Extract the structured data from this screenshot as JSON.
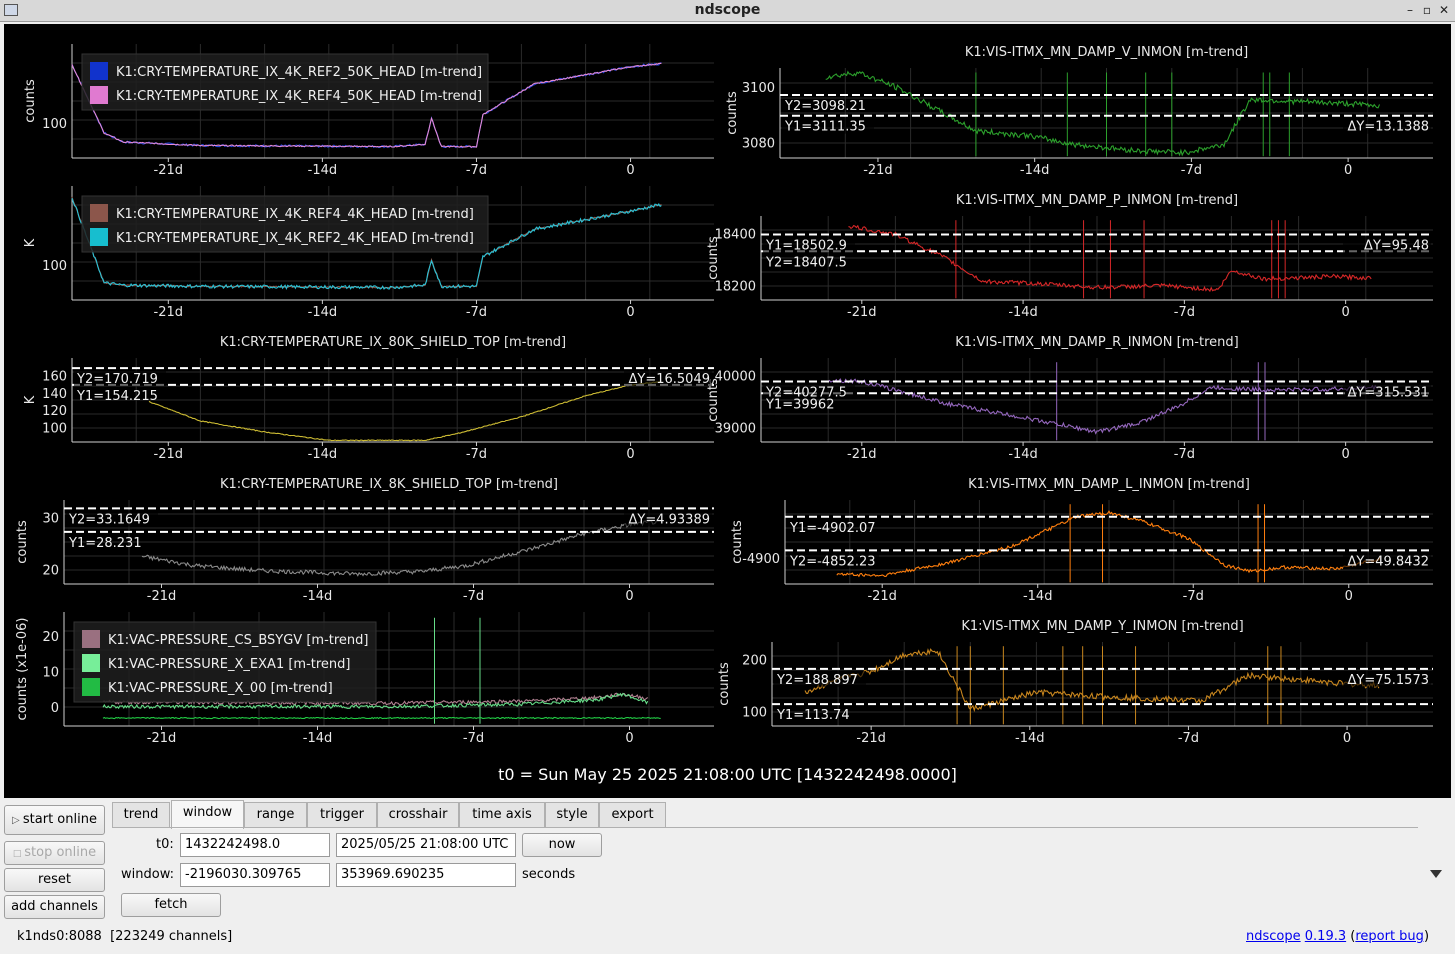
{
  "window": {
    "title": "ndscope",
    "minimize_glyph": "–",
    "maximize_glyph": "▫",
    "close_glyph": "✕"
  },
  "t0_label": "t0 = Sun May 25 2025 21:08:00 UTC [1432242498.0000]",
  "x_ticks": [
    "-21d",
    "-14d",
    "-7d",
    "0"
  ],
  "plots": [
    {
      "id": "left1",
      "ylabel": "counts",
      "yticks": [
        "100"
      ],
      "legend": [
        {
          "name": "K1:CRY-TEMPERATURE_IX_4K_REF2_50K_HEAD [m-trend]",
          "color": "#1133cc"
        },
        {
          "name": "K1:CRY-TEMPERATURE_IX_4K_REF4_50K_HEAD [m-trend]",
          "color": "#e07ad0"
        }
      ]
    },
    {
      "id": "left2",
      "ylabel": "K",
      "yticks": [
        "100"
      ],
      "legend": [
        {
          "name": "K1:CRY-TEMPERATURE_IX_4K_REF4_4K_HEAD [m-trend]",
          "color": "#8c564b"
        },
        {
          "name": "K1:CRY-TEMPERATURE_IX_4K_REF2_4K_HEAD [m-trend]",
          "color": "#17becf"
        }
      ]
    },
    {
      "id": "left3",
      "title": "K1:CRY-TEMPERATURE_IX_80K_SHIELD_TOP [m-trend]",
      "ylabel": "K",
      "yticks": [
        "160",
        "140",
        "120",
        "100"
      ],
      "y2": "Y2=170.719",
      "y1": "Y1=154.215",
      "dy": "ΔY=16.5049",
      "color": "#ccbb33"
    },
    {
      "id": "left4",
      "title": "K1:CRY-TEMPERATURE_IX_8K_SHIELD_TOP [m-trend]",
      "ylabel": "counts",
      "yticks": [
        "30",
        "20"
      ],
      "y2": "Y2=33.1649",
      "y1": "Y1=28.231",
      "dy": "ΔY=4.93389",
      "color": "#8a8a8a"
    },
    {
      "id": "left5",
      "ylabel": "counts (x1e-06)",
      "yticks": [
        "20",
        "10",
        "0"
      ],
      "legend": [
        {
          "name": "K1:VAC-PRESSURE_CS_BSYGV [m-trend]",
          "color": "#9a7080"
        },
        {
          "name": "K1:VAC-PRESSURE_X_EXA1 [m-trend]",
          "color": "#77ee99"
        },
        {
          "name": "K1:VAC-PRESSURE_X_00 [m-trend]",
          "color": "#22bb44"
        }
      ]
    },
    {
      "id": "right1",
      "title": "K1:VIS-ITMX_MN_DAMP_V_INMON [m-trend]",
      "ylabel": "counts",
      "yticks": [
        "3100",
        "3080"
      ],
      "y1": "Y1=3111.35",
      "y2": "Y2=3098.21",
      "dy": "ΔY=13.1388",
      "color": "#2ca02c"
    },
    {
      "id": "right2",
      "title": "K1:VIS-ITMX_MN_DAMP_P_INMON [m-trend]",
      "ylabel": "counts",
      "yticks": [
        "18400",
        "18200"
      ],
      "y1": "Y1=18502.9",
      "y2": "Y2=18407.5",
      "dy": "ΔY=95.48",
      "color": "#d62728"
    },
    {
      "id": "right3",
      "title": "K1:VIS-ITMX_MN_DAMP_R_INMON [m-trend]",
      "ylabel": "counts",
      "yticks": [
        "40000",
        "39000"
      ],
      "y2": "Y2=40277.5",
      "y1": "Y1=39962",
      "dy": "ΔY=315.531",
      "color": "#9467bd"
    },
    {
      "id": "right4",
      "title": "K1:VIS-ITMX_MN_DAMP_L_INMON [m-trend]",
      "ylabel": "counts",
      "yticks": [
        "-4900"
      ],
      "y2": "Y2=-4852.23",
      "y1": "Y1=-4902.07",
      "dy": "ΔY=49.8432",
      "color": "#ff7f0e"
    },
    {
      "id": "right5",
      "title": "K1:VIS-ITMX_MN_DAMP_Y_INMON [m-trend]",
      "ylabel": "counts",
      "yticks": [
        "200",
        "100"
      ],
      "y2": "Y2=188.897",
      "y1": "Y1=113.74",
      "dy": "ΔY=75.1573",
      "color": "#c8861e"
    }
  ],
  "left_buttons": {
    "start_online": "start online",
    "stop_online": "stop online",
    "reset": "reset",
    "add_channels": "add channels"
  },
  "tabs": [
    "trend",
    "window",
    "range",
    "trigger",
    "crosshair",
    "time axis",
    "style",
    "export"
  ],
  "window_tab": {
    "t0_label": "t0:",
    "t0_gps": "1432242498.0",
    "t0_utc": "2025/05/25 21:08:00 UTC",
    "now_label": "now",
    "window_label": "window:",
    "window_start": "-2196030.309765",
    "window_end": "353969.690235",
    "seconds_label": "seconds",
    "fetch_label": "fetch"
  },
  "status": {
    "server": "k1nds0:8088",
    "channels": "[223249 channels]",
    "app_name": "ndscope",
    "version": "0.19.3",
    "paren_open": "(",
    "report": "report bug",
    "paren_close": ")"
  }
}
